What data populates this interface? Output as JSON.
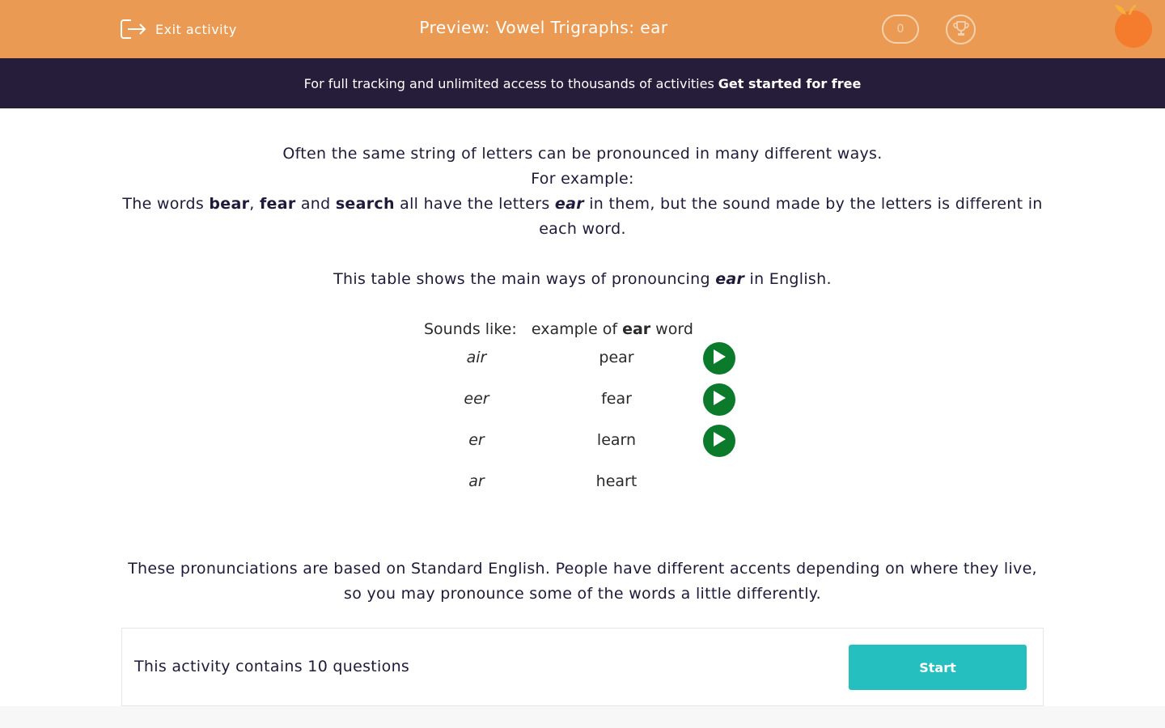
{
  "header": {
    "exit_label": "Exit activity",
    "title": "Preview: Vowel Trigraphs: ear",
    "score": "0"
  },
  "banner": {
    "text": "For full tracking and unlimited access to thousands of activities",
    "cta": "Get started for free"
  },
  "intro": {
    "line1": "Often the same string of letters can be pronounced in many different ways.",
    "line2": "For example:",
    "p3_a": "The words ",
    "word1": "bear",
    "comma": ", ",
    "word2": "fear",
    "and": " and ",
    "word3": "search",
    "p3_b": " all have the letters ",
    "letters": "ear",
    "p3_c": " in them, but the sound made by the letters is different in each word.",
    "p4_a": "This table shows the main ways of pronouncing ",
    "p4_letters": "ear",
    "p4_b": " in English."
  },
  "table": {
    "header_sound": "Sounds like:",
    "header_example_a": "example of ",
    "header_example_b": "ear",
    "header_example_c": " word",
    "rows": [
      {
        "sound": "air",
        "word": "pear",
        "has_audio": true
      },
      {
        "sound": "eer",
        "word": "fear",
        "has_audio": true
      },
      {
        "sound": "er",
        "word": "learn",
        "has_audio": true
      },
      {
        "sound": "ar",
        "word": "heart",
        "has_audio": false
      }
    ]
  },
  "note": "These pronunciations are based on Standard English. People have different accents depending on where they live, so you may pronounce some of the words a little differently.",
  "activity": {
    "count_text": "This activity contains 10 questions",
    "start_label": "Start"
  },
  "colors": {
    "header_bg": "#ea9a52",
    "banner_bg": "#261d3b",
    "play_button": "#0b7a2a",
    "start_button": "#26bfbf"
  },
  "icons": {
    "exit": "exit-door-icon",
    "trophy": "trophy-icon",
    "logo": "orange-fruit-logo",
    "play": "play-icon"
  }
}
